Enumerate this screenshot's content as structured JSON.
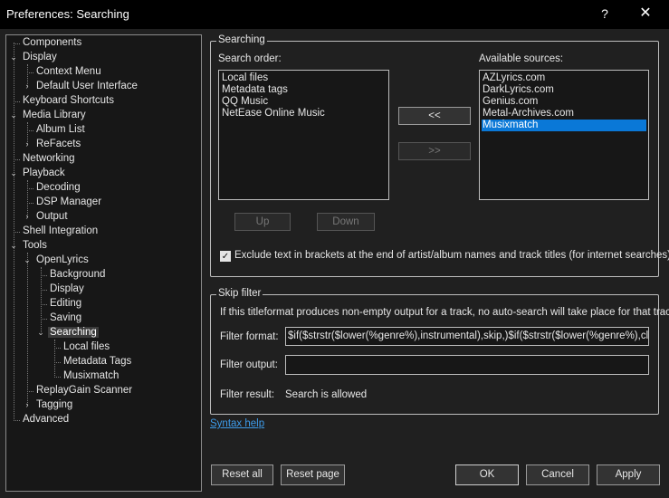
{
  "window": {
    "title": "Preferences: Searching",
    "help_label": "?",
    "close_label": "✕"
  },
  "tree": {
    "items": [
      {
        "label": "Components"
      },
      {
        "label": "Display"
      },
      {
        "label": "Context Menu"
      },
      {
        "label": "Default User Interface"
      },
      {
        "label": "Keyboard Shortcuts"
      },
      {
        "label": "Media Library"
      },
      {
        "label": "Album List"
      },
      {
        "label": "ReFacets"
      },
      {
        "label": "Networking"
      },
      {
        "label": "Playback"
      },
      {
        "label": "Decoding"
      },
      {
        "label": "DSP Manager"
      },
      {
        "label": "Output"
      },
      {
        "label": "Shell Integration"
      },
      {
        "label": "Tools"
      },
      {
        "label": "OpenLyrics"
      },
      {
        "label": "Background"
      },
      {
        "label": "Display"
      },
      {
        "label": "Editing"
      },
      {
        "label": "Saving"
      },
      {
        "label": "Searching"
      },
      {
        "label": "Local files"
      },
      {
        "label": "Metadata Tags"
      },
      {
        "label": "Musixmatch"
      },
      {
        "label": "ReplayGain Scanner"
      },
      {
        "label": "Tagging"
      },
      {
        "label": "Advanced"
      }
    ]
  },
  "searching": {
    "group_title": "Searching",
    "search_order_label": "Search order:",
    "available_label": "Available sources:",
    "search_order": [
      "Local files",
      "Metadata tags",
      "QQ Music",
      "NetEase Online Music"
    ],
    "available": [
      "AZLyrics.com",
      "DarkLyrics.com",
      "Genius.com",
      "Metal-Archives.com",
      "Musixmatch"
    ],
    "add_label": "<<",
    "remove_label": ">>",
    "up_label": "Up",
    "down_label": "Down",
    "exclude_label": "Exclude text in brackets at the end of artist/album names and track titles (for internet searches)",
    "exclude_checked": true
  },
  "skip_filter": {
    "group_title": "Skip filter",
    "description": "If this titleformat produces non-empty output for a track, no auto-search will take place for that track",
    "format_label": "Filter format:",
    "format_value": "$if($strstr($lower(%genre%),instrumental),skip,)$if($strstr($lower(%genre%),classical),skip,)",
    "output_label": "Filter output:",
    "output_value": "",
    "result_label": "Filter result:",
    "result_value": "Search is allowed"
  },
  "syntax_help": "Syntax help",
  "footer": {
    "reset_all": "Reset all",
    "reset_page": "Reset page",
    "ok": "OK",
    "cancel": "Cancel",
    "apply": "Apply"
  }
}
